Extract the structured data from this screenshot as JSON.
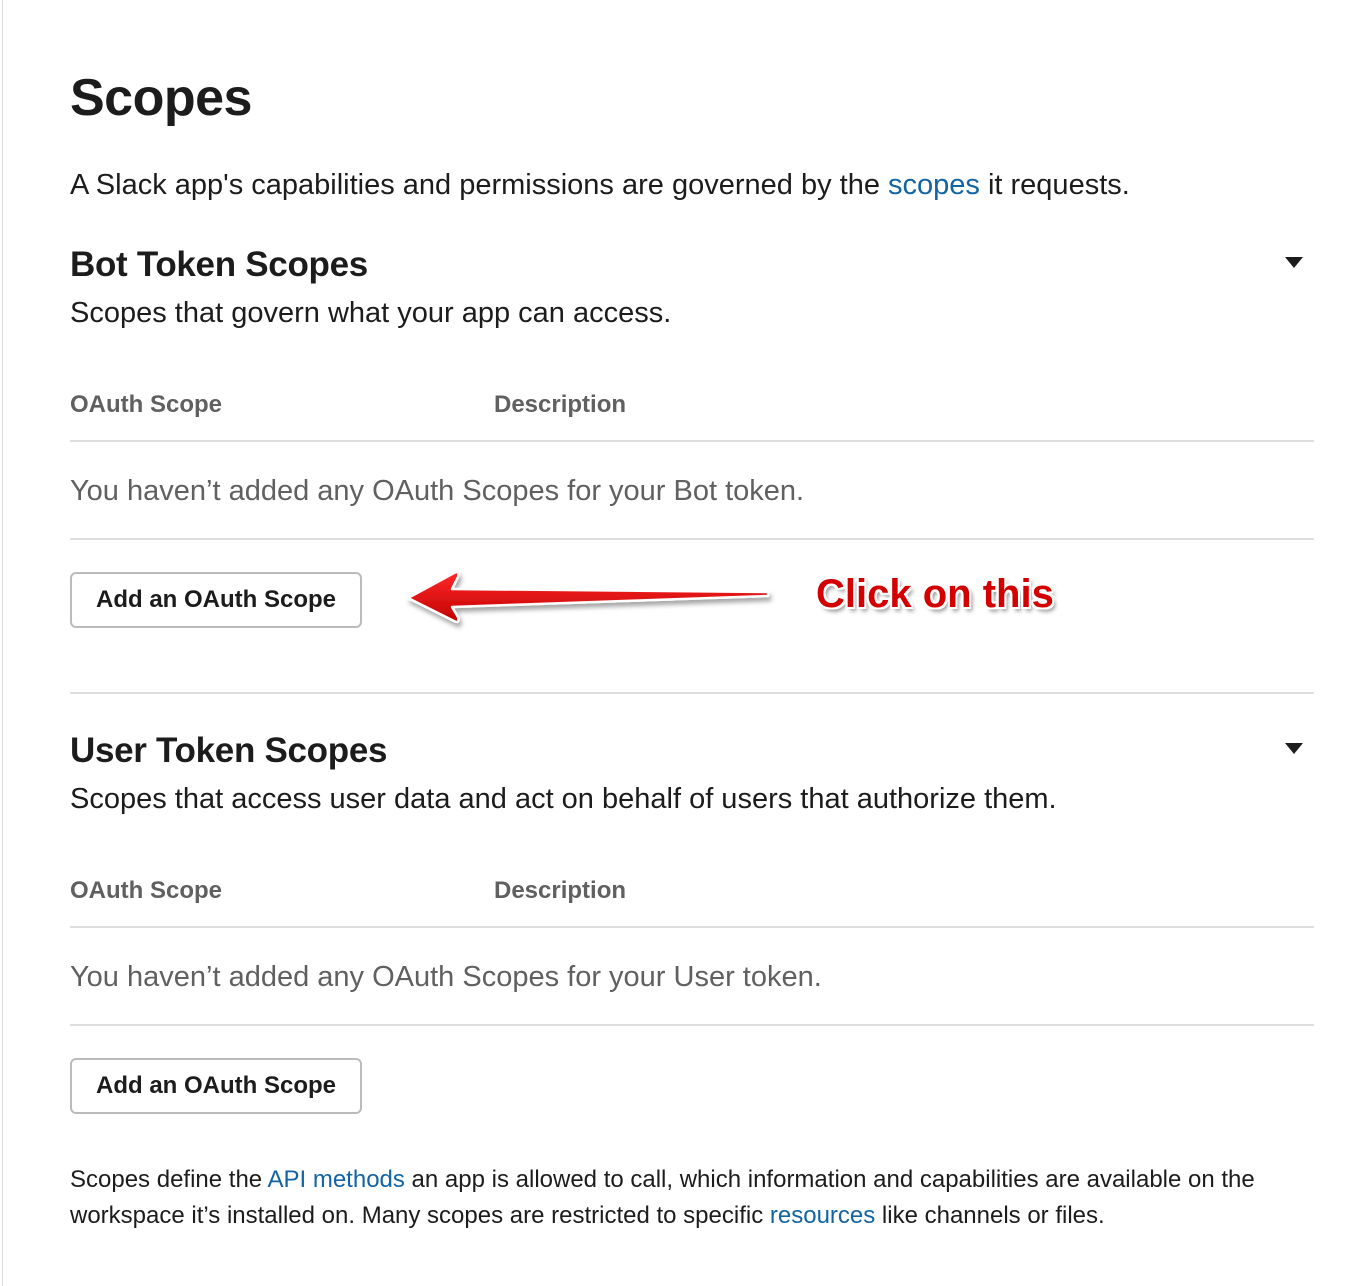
{
  "page": {
    "title": "Scopes",
    "intro_before": "A Slack app's capabilities and permissions are governed by the ",
    "intro_link": "scopes",
    "intro_after": " it requests."
  },
  "bot_section": {
    "title": "Bot Token Scopes",
    "subtitle": "Scopes that govern what your app can access.",
    "columns": [
      "OAuth Scope",
      "Description"
    ],
    "empty_message": "You haven’t added any OAuth Scopes for your Bot token.",
    "button_label": "Add an OAuth Scope"
  },
  "user_section": {
    "title": "User Token Scopes",
    "subtitle": "Scopes that access user data and act on behalf of users that authorize them.",
    "columns": [
      "OAuth Scope",
      "Description"
    ],
    "empty_message": "You haven’t added any OAuth Scopes for your User token.",
    "button_label": "Add an OAuth Scope"
  },
  "footer": {
    "text_1": "Scopes define the ",
    "link_1": "API methods",
    "text_2": " an app is allowed to call, which information and capabilities are available on the workspace it’s installed on. Many scopes are restricted to specific ",
    "link_2": "resources",
    "text_3": " like channels or files."
  },
  "annotation": {
    "text": "Click on this",
    "color": "#d40000"
  },
  "colors": {
    "link": "#1264a3",
    "text": "#1d1c1d",
    "muted": "#616061",
    "divider": "#dddddd"
  },
  "icons": {
    "collapse": "caret-down-icon",
    "annotation": "arrow-left-icon"
  }
}
